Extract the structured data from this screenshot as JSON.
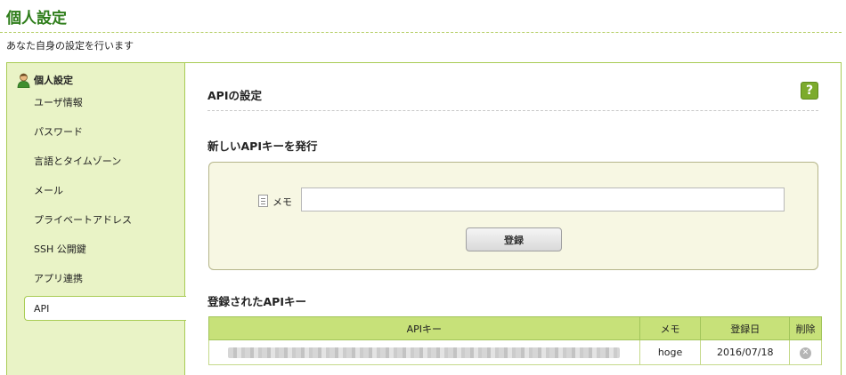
{
  "page": {
    "title": "個人設定",
    "description": "あなた自身の設定を行います"
  },
  "sidebar": {
    "header": "個人設定",
    "items": [
      {
        "label": "ユーザ情報"
      },
      {
        "label": "パスワード"
      },
      {
        "label": "言語とタイムゾーン"
      },
      {
        "label": "メール"
      },
      {
        "label": "プライベートアドレス"
      },
      {
        "label": "SSH 公開鍵"
      },
      {
        "label": "アプリ連携"
      },
      {
        "label": "API"
      }
    ],
    "active_index": 7
  },
  "main": {
    "section_title": "APIの設定",
    "help_label": "?",
    "issue_title": "新しいAPIキーを発行",
    "memo_label": "メモ",
    "memo_value": "",
    "register_button": "登録",
    "registered_title": "登録されたAPIキー",
    "table": {
      "headers": [
        "APIキー",
        "メモ",
        "登録日",
        "削除"
      ],
      "rows": [
        {
          "memo": "hoge",
          "date": "2016/07/18"
        }
      ]
    }
  },
  "icons": {
    "sidebar_header": "person-icon",
    "memo": "memo-icon",
    "delete": "delete-icon",
    "help": "help-icon"
  },
  "colors": {
    "accent_green": "#2e7d1a",
    "sidebar_bg": "#e9f3c6",
    "table_header_bg": "#c7e179",
    "form_bg": "#f7f7e3"
  }
}
